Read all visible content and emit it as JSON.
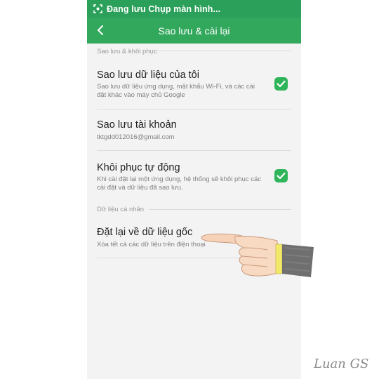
{
  "status_bar": {
    "text": "Đang lưu Chụp màn hình...",
    "icon": "screenshot-icon"
  },
  "app_bar": {
    "title": "Sao lưu & cài lại",
    "back_icon": "back-arrow-icon"
  },
  "sections": {
    "backup": "Sao lưu & khôi phục",
    "personal": "Dữ liệu cá nhân"
  },
  "items": [
    {
      "title": "Sao lưu dữ liệu của tôi",
      "subtitle": "Sao lưu dữ liệu ứng dụng, mật khẩu Wi-Fi, và các cài đặt khác vào máy chủ Google",
      "checked": true
    },
    {
      "title": "Sao lưu tài khoản",
      "subtitle": "tktgdd012016@gmail.com"
    },
    {
      "title": "Khôi phục tự động",
      "subtitle": "Khi cài đặt lại một ứng dụng, hệ thống sẽ khôi phục các cài đặt và dữ liệu đã sao lưu.",
      "checked": true
    },
    {
      "title": "Đặt lại về dữ liệu gốc",
      "subtitle": "Xóa tết cả các dữ liệu trên điện thoại"
    }
  ],
  "colors": {
    "status_bar": "#2ba05a",
    "app_bar": "#32a85c",
    "check": "#2fb45a",
    "background": "#f3f3f3"
  },
  "watermark": "Luan GS"
}
